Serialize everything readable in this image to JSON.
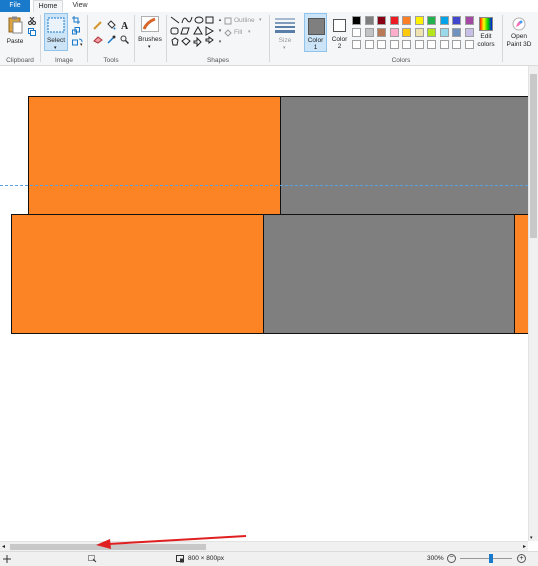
{
  "menu": {
    "file": "File",
    "home": "Home",
    "view": "View"
  },
  "ribbon": {
    "paste": "Paste",
    "clipboard": "Clipboard",
    "select": "Select",
    "image": "Image",
    "tools": "Tools",
    "brushes": "Brushes",
    "outline": "Outline",
    "fill": "Fill",
    "shapes": "Shapes",
    "size": "Size",
    "color1_a": "Color",
    "color1_b": "1",
    "color2_a": "Color",
    "color2_b": "2",
    "edit_colors_a": "Edit",
    "edit_colors_b": "colors",
    "colors": "Colors",
    "open_paint3d_a": "Open",
    "open_paint3d_b": "Paint 3D"
  },
  "palette_row1": [
    "#000000",
    "#7f7f7f",
    "#880015",
    "#ed1c24",
    "#ff7f27",
    "#fff200",
    "#22b14c",
    "#00a2e8",
    "#3f48cc",
    "#a349a4"
  ],
  "palette_row2": [
    "#ffffff",
    "#c3c3c3",
    "#b97a57",
    "#ffaec9",
    "#ffc90e",
    "#efe4b0",
    "#b5e61d",
    "#99d9ea",
    "#7092be",
    "#c8bfe7"
  ],
  "colors": {
    "orange": "#fd8424",
    "gray": "#7f7f7f",
    "arrow": "#e02020"
  },
  "status": {
    "dimensions": "800 × 800px",
    "zoom": "300%"
  }
}
